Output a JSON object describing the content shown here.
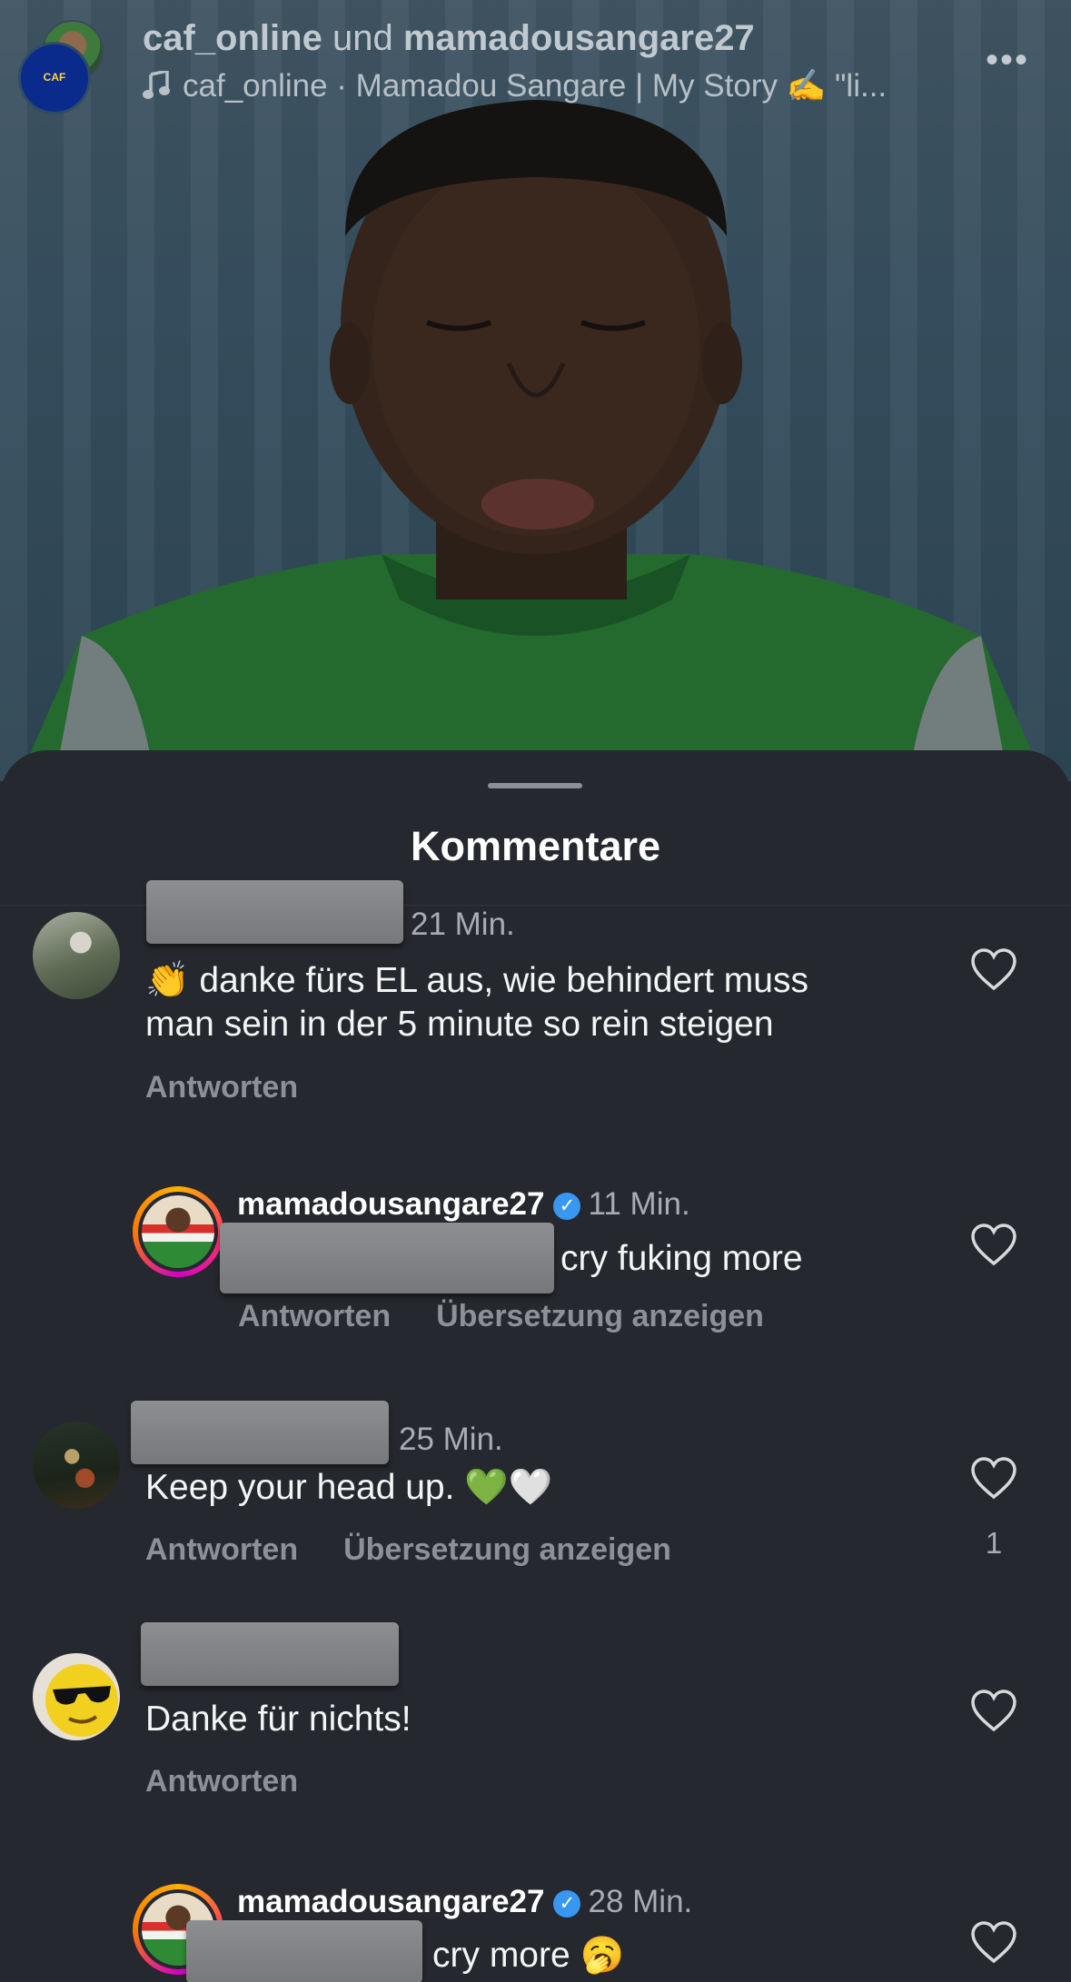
{
  "header": {
    "account_1": "caf_online",
    "joiner": "und",
    "account_2": "mamadousangare27",
    "audio_icon": "music-note-icon",
    "audio_text": "caf_online · Mamadou Sangare | My Story ✍️ \"li...",
    "more_icon": "ellipsis-icon",
    "more_label": "•••"
  },
  "sheet": {
    "title": "Kommentare"
  },
  "comments": [
    {
      "time": "21 Min.",
      "emoji": "👏",
      "line1": "danke fürs EL aus, wie behindert muss",
      "line2": "man sein in der 5 minute so  rein steigen",
      "reply": "Antworten"
    },
    {
      "user": "mamadousangare27",
      "verified": "✓",
      "time": "11 Min.",
      "text": "cry fuking more",
      "reply": "Antworten",
      "translate": "Übersetzung anzeigen"
    },
    {
      "time": "25 Min.",
      "text": "Keep your head up. 💚🤍",
      "reply": "Antworten",
      "translate": "Übersetzung anzeigen",
      "likes": "1"
    },
    {
      "text": "Danke für nichts!",
      "reply": "Antworten"
    },
    {
      "user": "mamadousangare27",
      "verified": "✓",
      "time": "28 Min.",
      "text": "cry more 🥱"
    }
  ],
  "colors": {
    "sheet_bg": "#25282e",
    "verified_blue": "#3897f0",
    "muted_text": "#8d9197"
  }
}
